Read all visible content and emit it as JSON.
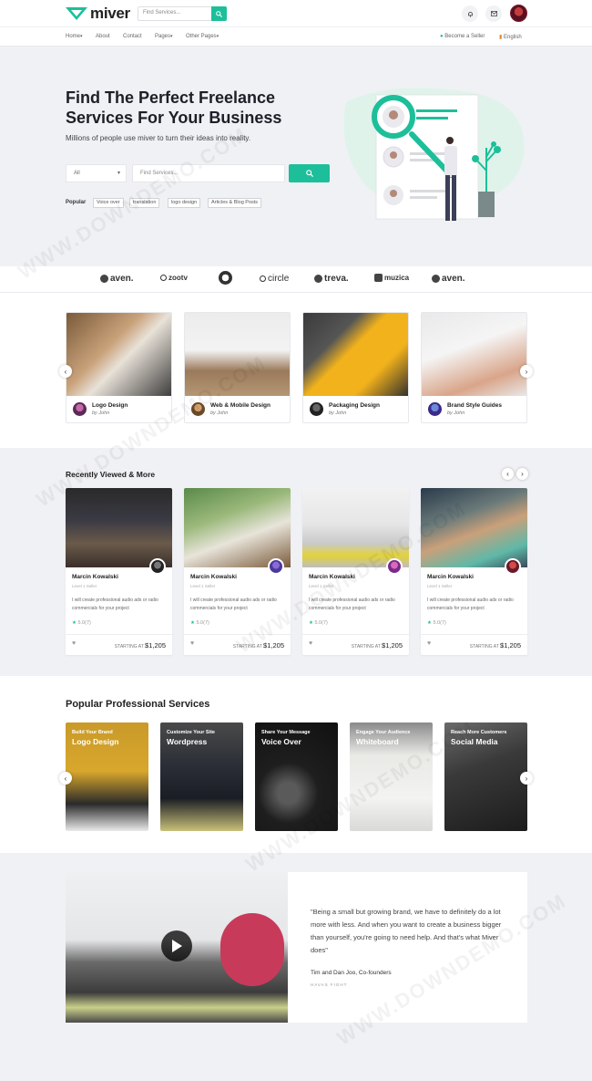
{
  "brand": {
    "name": "miver",
    "accent": "#1dbf9a"
  },
  "header": {
    "search_placeholder": "Find Services...",
    "icons": [
      "search-icon",
      "bell-icon",
      "mail-icon"
    ]
  },
  "nav": {
    "items": [
      "Home",
      "About",
      "Contact",
      "Pages",
      "Other Pages"
    ],
    "become_seller": "Become a Seller",
    "language": "English"
  },
  "hero": {
    "title": "Find The Perfect Freelance Services For Your Business",
    "subtitle": "Millions of people use miver to turn their ideas into reality.",
    "select_value": "All",
    "search_placeholder": "Find Services...",
    "popular_label": "Popular",
    "tags": [
      "Voice over",
      "translation",
      "logo design",
      "Articles & Blog Posts"
    ]
  },
  "brands": [
    "aven.",
    "zootv",
    "",
    "circle",
    "treva.",
    "muzica",
    "aven."
  ],
  "categories": [
    {
      "title": "Logo Design",
      "by": "by John"
    },
    {
      "title": "Web & Mobile Design",
      "by": "by John"
    },
    {
      "title": "Packaging Design",
      "by": "by John"
    },
    {
      "title": "Brand Style Guides",
      "by": "by John"
    }
  ],
  "recently_viewed": {
    "title": "Recently Viewed & More",
    "cards": [
      {
        "name": "Marcin Kowalski",
        "level": "Level 1 Seller",
        "desc": "I will create professional audio ads or radio commercials for your project",
        "rating": "5.0",
        "count": "(7)",
        "starting": "STARTING AT",
        "price": "$1,205"
      },
      {
        "name": "Marcin Kowalski",
        "level": "Level 1 Seller",
        "desc": "I will create professional audio ads or radio commercials for your project",
        "rating": "5.0",
        "count": "(7)",
        "starting": "STARTING AT",
        "price": "$1,205"
      },
      {
        "name": "Marcin Kowalski",
        "level": "Level 1 Seller",
        "desc": "I will create professional audio ads or radio commercials for your project",
        "rating": "5.0",
        "count": "(7)",
        "starting": "STARTING AT",
        "price": "$1,205"
      },
      {
        "name": "Marcin Kowalski",
        "level": "Level 1 Seller",
        "desc": "I will create professional audio ads or radio commercials for your project",
        "rating": "5.0",
        "count": "(7)",
        "starting": "STARTING AT",
        "price": "$1,205"
      }
    ]
  },
  "popular_services": {
    "title": "Popular Professional Services",
    "cards": [
      {
        "small": "Build Your Brand",
        "big": "Logo Design"
      },
      {
        "small": "Customize Your Site",
        "big": "Wordpress"
      },
      {
        "small": "Share Your Message",
        "big": "Voice Over"
      },
      {
        "small": "Engage Your Audience",
        "big": "Whiteboard"
      },
      {
        "small": "Reach More Customers",
        "big": "Social Media"
      }
    ]
  },
  "testimonial": {
    "quote": "\"Being a small but growing brand, we have to definitely do a lot more with less. And when you want to create a business bigger than yourself, you're going to need help. And that's what Miver does\"",
    "author": "Tim and Dan Joo, Co-founders",
    "role": "HAVAS FIGHT"
  },
  "watermark": "WWW.DOWNDEMO.COM"
}
